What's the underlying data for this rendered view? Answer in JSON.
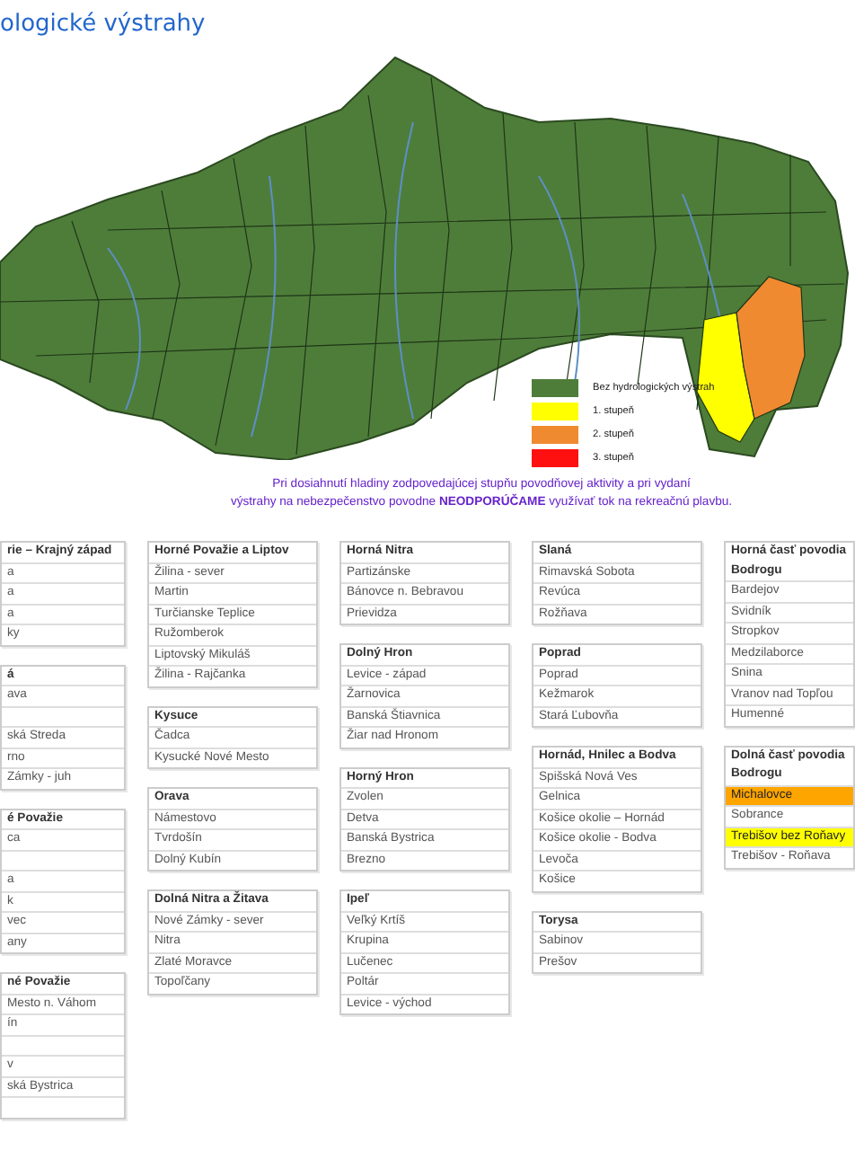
{
  "title": "ologické výstrahy",
  "legend": [
    {
      "label": "Bez hydrologických výstrah",
      "color": "#4e7d3a"
    },
    {
      "label": "1. stupeň",
      "color": "#ffff00"
    },
    {
      "label": "2. stupeň",
      "color": "#f08a30"
    },
    {
      "label": "3. stupeň",
      "color": "#ff1010"
    }
  ],
  "note": [
    "Pri dosiahnutí hladiny zodpovedajúcej stupňu povodňovej aktivity a pri vydaní",
    "výstrahy na nebezpečenstvo povodne **NEODPORÚČAME** využívať tok na rekreačnú plavbu."
  ],
  "columns": [
    {
      "tables": [
        {
          "title": "rie – Krajný západ",
          "rows": [
            {
              "text": "a"
            },
            {
              "text": "a"
            },
            {
              "text": "a"
            },
            {
              "text": "ky"
            }
          ]
        },
        {
          "title": "á",
          "rows": [
            {
              "text": "ava"
            },
            {},
            {
              "text": "ská Streda"
            },
            {
              "text": "rno"
            },
            {
              "text": "Zámky - juh"
            }
          ]
        },
        {
          "title": "é Považie",
          "rows": [
            {
              "text": "ca"
            },
            {},
            {
              "text": "a"
            },
            {
              "text": "k"
            },
            {
              "text": "vec"
            },
            {
              "text": "any"
            }
          ]
        },
        {
          "title": "né Považie",
          "rows": [
            {
              "text": "Mesto n. Váhom"
            },
            {
              "text": "ín"
            },
            {},
            {
              "text": "v"
            },
            {
              "text": "ská Bystrica"
            },
            {}
          ]
        }
      ]
    },
    {
      "tables": [
        {
          "title": "Horné Považie a Liptov",
          "rows": [
            {
              "text": "Žilina - sever"
            },
            {
              "text": "Martin"
            },
            {
              "text": "Turčianske Teplice"
            },
            {
              "text": "Ružomberok"
            },
            {
              "text": "Liptovský Mikuláš"
            },
            {
              "text": "Žilina - Rajčanka"
            }
          ]
        },
        {
          "title": "Kysuce",
          "rows": [
            {
              "text": "Čadca"
            },
            {
              "text": "Kysucké Nové Mesto"
            }
          ]
        },
        {
          "title": "Orava",
          "rows": [
            {
              "text": "Námestovo"
            },
            {
              "text": "Tvrdošín"
            },
            {
              "text": "Dolný Kubín"
            }
          ]
        },
        {
          "title": "Dolná Nitra a Žitava",
          "rows": [
            {
              "text": "Nové Zámky - sever"
            },
            {
              "text": "Nitra"
            },
            {
              "text": "Zlaté Moravce"
            },
            {
              "text": "Topoľčany"
            }
          ]
        }
      ]
    },
    {
      "tables": [
        {
          "title": "Horná Nitra",
          "rows": [
            {
              "text": "Partizánske"
            },
            {
              "text": "Bánovce n. Bebravou"
            },
            {
              "text": "Prievidza"
            }
          ]
        },
        {
          "title": "Dolný Hron",
          "rows": [
            {
              "text": "Levice - západ"
            },
            {
              "text": "Žarnovica"
            },
            {
              "text": "Banská Štiavnica"
            },
            {
              "text": "Žiar nad Hronom"
            }
          ]
        },
        {
          "title": "Horný Hron",
          "rows": [
            {
              "text": "Zvolen"
            },
            {
              "text": "Detva"
            },
            {
              "text": "Banská Bystrica"
            },
            {
              "text": "Brezno"
            }
          ]
        },
        {
          "title": "Ipeľ",
          "rows": [
            {
              "text": "Veľký Krtíš"
            },
            {
              "text": "Krupina"
            },
            {
              "text": "Lučenec"
            },
            {
              "text": "Poltár"
            },
            {
              "text": "Levice - východ"
            }
          ]
        }
      ]
    },
    {
      "tables": [
        {
          "title": "Slaná",
          "rows": [
            {
              "text": "Rimavská Sobota"
            },
            {
              "text": "Revúca"
            },
            {
              "text": "Rožňava"
            }
          ]
        },
        {
          "title": "Poprad",
          "rows": [
            {
              "text": "Poprad"
            },
            {
              "text": "Kežmarok"
            },
            {
              "text": "Stará Ľubovňa"
            }
          ]
        },
        {
          "title": "Hornád, Hnilec a Bodva",
          "rows": [
            {
              "text": "Spišská Nová Ves"
            },
            {
              "text": "Gelnica"
            },
            {
              "text": "Košice okolie – Hornád"
            },
            {
              "text": "Košice okolie - Bodva"
            },
            {
              "text": "Levoča"
            },
            {
              "text": "Košice"
            }
          ]
        },
        {
          "title": "Torysa",
          "rows": [
            {
              "text": "Sabinov"
            },
            {
              "text": "Prešov"
            }
          ]
        }
      ]
    },
    {
      "tables": [
        {
          "title": "Horná časť povodia Bodrogu",
          "rows": [
            {
              "text": "Bardejov"
            },
            {
              "text": "Svidník"
            },
            {
              "text": "Stropkov"
            },
            {
              "text": "Medzilaborce"
            },
            {
              "text": "Snina"
            },
            {
              "text": "Vranov nad Topľou"
            },
            {
              "text": "Humenné"
            }
          ]
        },
        {
          "title": "Dolná časť povodia Bodrogu",
          "rows": [
            {
              "text": "Michalovce",
              "color": "#ffa500"
            },
            {
              "text": "Sobrance"
            },
            {
              "text": "Trebišov bez Roňavy",
              "color": "#ffff00"
            },
            {
              "text": "Trebišov - Roňava"
            }
          ]
        }
      ]
    }
  ]
}
